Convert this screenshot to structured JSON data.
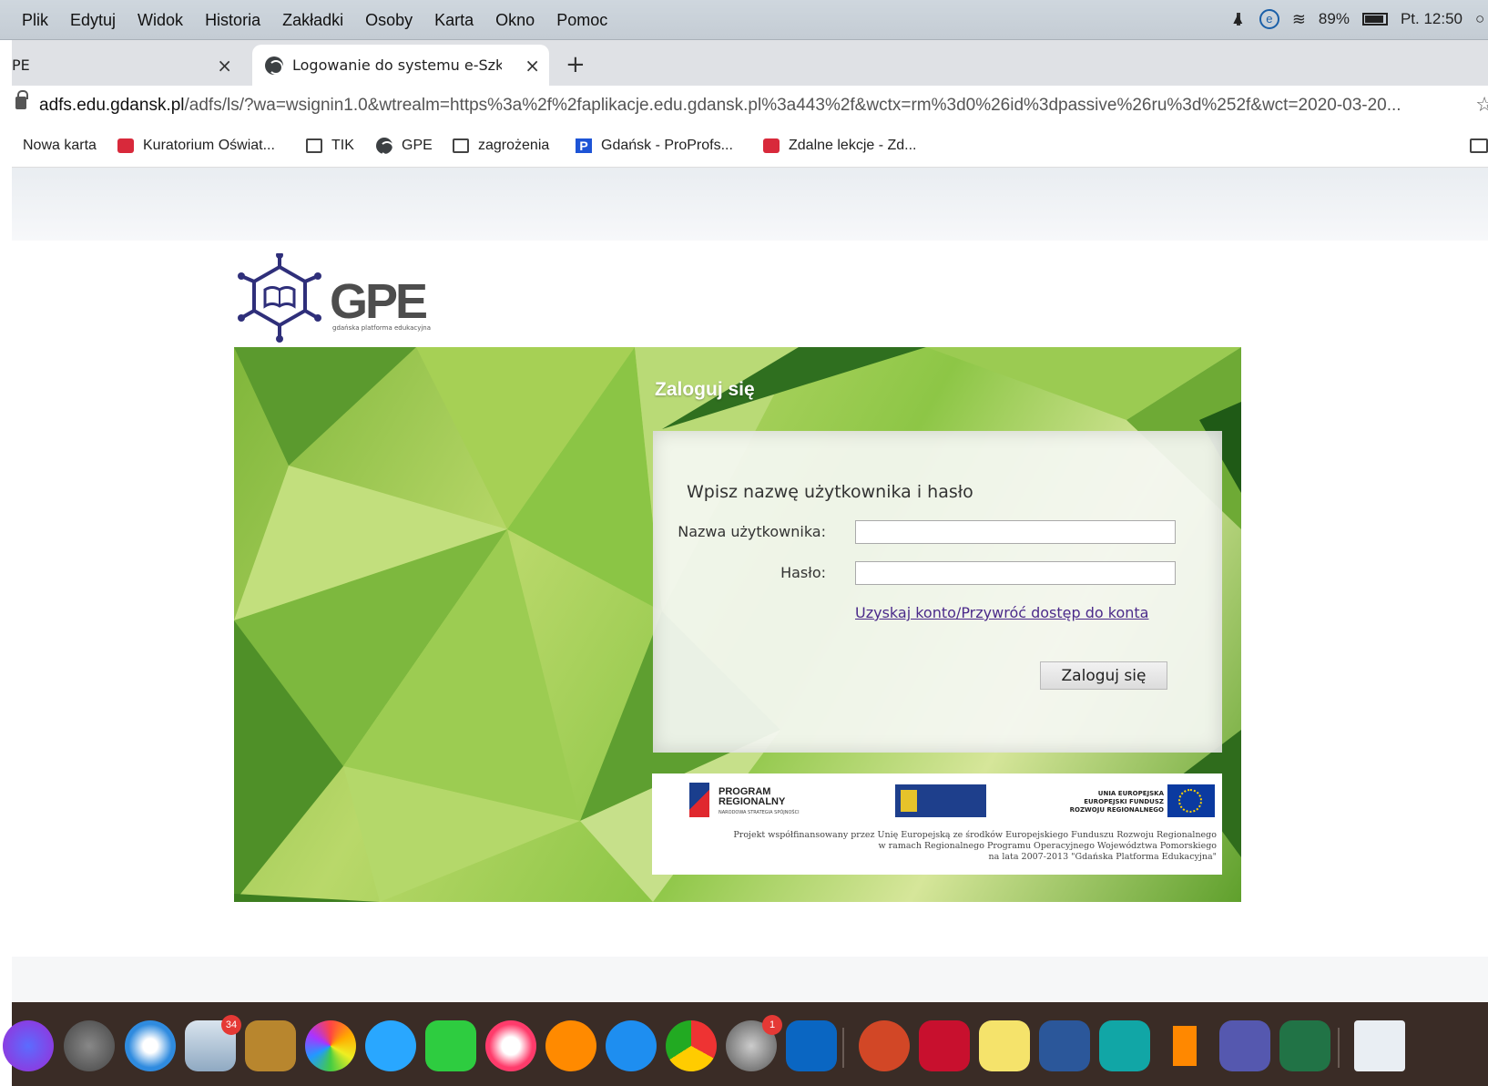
{
  "menubar": {
    "items": [
      "Plik",
      "Edytuj",
      "Widok",
      "Historia",
      "Zakładki",
      "Osoby",
      "Karta",
      "Okno",
      "Pomoc"
    ],
    "battery": "89%",
    "clock": "Pt. 12:50"
  },
  "tabs": [
    {
      "label": "PE",
      "active": false
    },
    {
      "label": "Logowanie do systemu e-Szko",
      "active": true
    }
  ],
  "address": {
    "domain": "adfs.edu.gdansk.pl",
    "path": "/adfs/ls/?wa=wsignin1.0&wtrealm=https%3a%2f%2faplikacje.edu.gdansk.pl%3a443%2f&wctx=rm%3d0%26id%3dpassive%26ru%3d%252f&wct=2020-03-20..."
  },
  "bookmarks": [
    {
      "label": "Nowa karta",
      "icon": "none"
    },
    {
      "label": "Kuratorium Oświat...",
      "icon": "emblem-icon"
    },
    {
      "label": "TIK",
      "icon": "folder-icon"
    },
    {
      "label": "GPE",
      "icon": "globe-icon"
    },
    {
      "label": "zagrożenia",
      "icon": "folder-icon"
    },
    {
      "label": "Gdańsk - ProProfs...",
      "icon": "p-icon"
    },
    {
      "label": "Zdalne lekcje - Zd...",
      "icon": "emblem-icon"
    }
  ],
  "logo": {
    "word": "GPE",
    "subtitle": "gdańska platforma edukacyjna"
  },
  "login": {
    "title": "Zaloguj się",
    "instruction": "Wpisz nazwę użytkownika i hasło",
    "username_label": "Nazwa użytkownika:",
    "password_label": "Hasło:",
    "username_value": "",
    "password_value": "",
    "recover_link": "Uzyskaj konto/Przywróć dostęp do konta",
    "submit": "Zaloguj się"
  },
  "eu": {
    "program_line1": "PROGRAM",
    "program_line2": "REGIONALNY",
    "program_small": "NARODOWA STRATEGIA SPÓJNOŚCI",
    "ue_line1": "UNIA EUROPEJSKA",
    "ue_line2": "EUROPEJSKI FUNDUSZ",
    "ue_line3": "ROZWOJU REGIONALNEGO",
    "note_line1": "Projekt współfinansowany przez Unię Europejską ze środków Europejskiego Funduszu Rozwoju Regionalnego",
    "note_line2": "w ramach Regionalnego Programu Operacyjnego Województwa Pomorskiego",
    "note_line3": "na lata 2007-2013 \"Gdańska Platforma Edukacyjna\""
  },
  "dock": {
    "mail_badge": "34",
    "settings_badge": "1",
    "apps": [
      "siri",
      "launchpad",
      "safari",
      "mail",
      "contacts",
      "photos",
      "messages",
      "facetime",
      "music",
      "books",
      "app-store",
      "chrome",
      "system-preferences",
      "outlook",
      "powerpoint",
      "acrobat",
      "stickies",
      "word",
      "eset",
      "vlc",
      "teams",
      "excel",
      "finder-window"
    ]
  },
  "colors": {
    "accent_link": "#4b2a8a",
    "banner_green": "#8dc646",
    "dock": "#3a2c26"
  }
}
